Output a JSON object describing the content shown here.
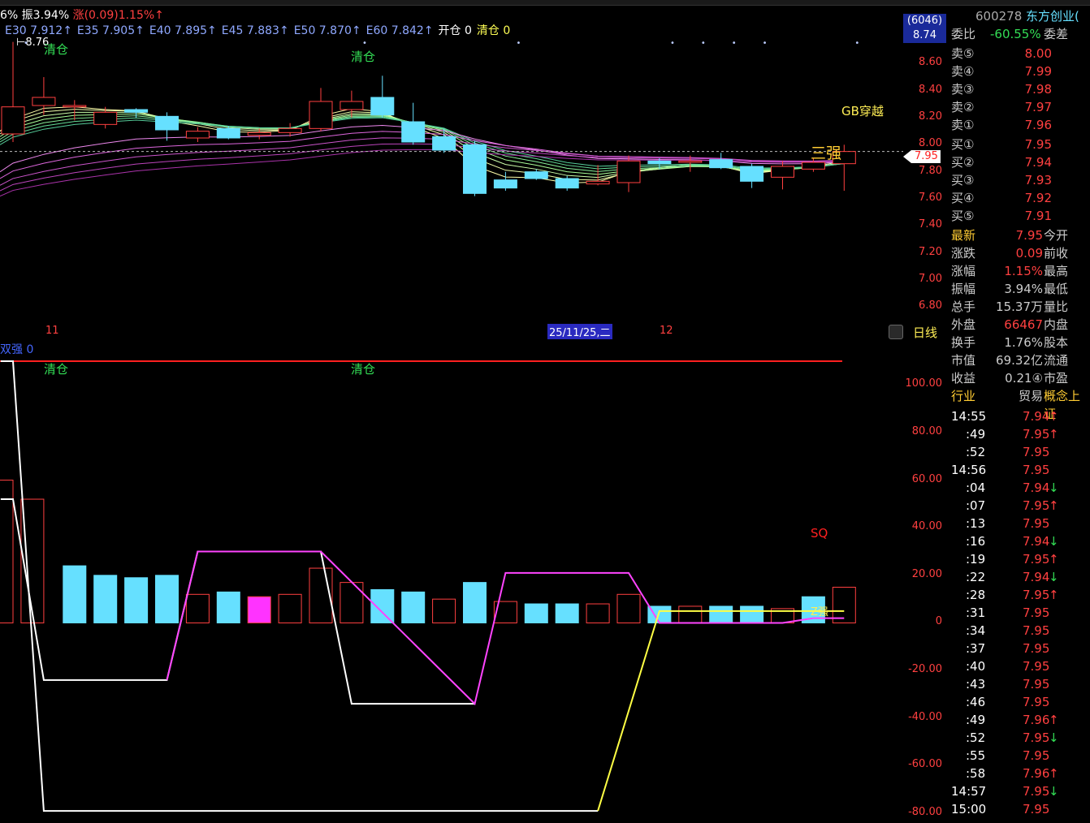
{
  "header": {
    "segments": [
      {
        "text": "6% 振3.94%",
        "color": "#ffffff"
      },
      {
        "text": "涨(0.09)1.15%↑",
        "color": "#ff4040"
      }
    ],
    "ma_labels": [
      {
        "text": "E30 7.912↑",
        "color": "#8fa8ff"
      },
      {
        "text": "E35 7.905↑",
        "color": "#8fa8ff"
      },
      {
        "text": "E40 7.895↑",
        "color": "#8fa8ff"
      },
      {
        "text": "E45 7.883↑",
        "color": "#8fa8ff"
      },
      {
        "text": "E50 7.870↑",
        "color": "#8fa8ff"
      },
      {
        "text": "E60 7.842↑",
        "color": "#8fa8ff"
      },
      {
        "text": "开仓 0",
        "color": "#ffffff"
      },
      {
        "text": "清仓 0",
        "color": "#ffff55"
      }
    ],
    "high_marker": "8.76"
  },
  "main_chart": {
    "labels": {
      "qingcang": "清仓",
      "gb_cross": "GB穿越",
      "san_qiang": "三强",
      "current_price": "7.95"
    },
    "date_labels": {
      "month_11": "11",
      "cursor_date": "25/11/25,二",
      "month_12": "12"
    },
    "period_label": "日线",
    "y_ticks": [
      "8.60",
      "8.40",
      "8.20",
      "8.00",
      "7.80",
      "7.60",
      "7.40",
      "7.20",
      "7.00",
      "6.80"
    ]
  },
  "sub_chart": {
    "title": "双强 0",
    "labels": {
      "qingcang": "清仓",
      "sq": "SQ",
      "z_label": "Z强"
    },
    "y_ticks": [
      "100.00",
      "80.00",
      "60.00",
      "40.00",
      "20.00",
      "0",
      "-20.00",
      "-40.00",
      "-60.00",
      "-80.00"
    ]
  },
  "chart_data": [
    {
      "type": "candlestick",
      "title": "",
      "ylim": [
        6.7,
        8.8
      ],
      "y_ticks": [
        6.8,
        7.0,
        7.2,
        7.4,
        7.6,
        7.8,
        8.0,
        8.2,
        8.4,
        8.6
      ],
      "current_price": 7.95,
      "candles": [
        {
          "o": 8.08,
          "c": 8.28,
          "h": 8.76,
          "l": 8.02
        },
        {
          "o": 8.29,
          "c": 8.35,
          "h": 8.5,
          "l": 8.22
        },
        {
          "o": 8.28,
          "c": 8.29,
          "h": 8.33,
          "l": 8.18
        },
        {
          "o": 8.15,
          "c": 8.24,
          "h": 8.28,
          "l": 8.12
        },
        {
          "o": 8.26,
          "c": 8.24,
          "h": 8.27,
          "l": 8.2
        },
        {
          "o": 8.21,
          "c": 8.11,
          "h": 8.24,
          "l": 8.03
        },
        {
          "o": 8.05,
          "c": 8.1,
          "h": 8.13,
          "l": 8.02
        },
        {
          "o": 8.12,
          "c": 8.05,
          "h": 8.14,
          "l": 8.04
        },
        {
          "o": 8.07,
          "c": 8.09,
          "h": 8.12,
          "l": 8.04
        },
        {
          "o": 8.09,
          "c": 8.12,
          "h": 8.16,
          "l": 8.06
        },
        {
          "o": 8.12,
          "c": 8.32,
          "h": 8.42,
          "l": 8.1
        },
        {
          "o": 8.26,
          "c": 8.32,
          "h": 8.4,
          "l": 8.2
        },
        {
          "o": 8.35,
          "c": 8.22,
          "h": 8.51,
          "l": 8.2
        },
        {
          "o": 8.17,
          "c": 8.02,
          "h": 8.31,
          "l": 8.0
        },
        {
          "o": 8.06,
          "c": 7.96,
          "h": 8.12,
          "l": 7.94
        },
        {
          "o": 8.0,
          "c": 7.64,
          "h": 8.03,
          "l": 7.62
        },
        {
          "o": 7.74,
          "c": 7.68,
          "h": 7.8,
          "l": 7.66
        },
        {
          "o": 7.8,
          "c": 7.75,
          "h": 7.82,
          "l": 7.74
        },
        {
          "o": 7.75,
          "c": 7.68,
          "h": 7.77,
          "l": 7.66
        },
        {
          "o": 7.71,
          "c": 7.73,
          "h": 7.85,
          "l": 7.7
        },
        {
          "o": 7.72,
          "c": 7.88,
          "h": 7.92,
          "l": 7.65
        },
        {
          "o": 7.88,
          "c": 7.86,
          "h": 7.9,
          "l": 7.82
        },
        {
          "o": 7.87,
          "c": 7.88,
          "h": 7.92,
          "l": 7.8
        },
        {
          "o": 7.89,
          "c": 7.83,
          "h": 7.94,
          "l": 7.82
        },
        {
          "o": 7.84,
          "c": 7.73,
          "h": 7.86,
          "l": 7.68
        },
        {
          "o": 7.76,
          "c": 7.84,
          "h": 7.88,
          "l": 7.67
        },
        {
          "o": 7.82,
          "c": 7.87,
          "h": 7.9,
          "l": 7.8
        },
        {
          "o": 7.86,
          "c": 7.95,
          "h": 8.0,
          "l": 7.66
        }
      ],
      "markers": {
        "qingcang_at": [
          1,
          11
        ],
        "san_qiang_at": 26,
        "top_dots_at": [
          0,
          11,
          16,
          21,
          22,
          23,
          24,
          27
        ]
      }
    },
    {
      "type": "bar+line",
      "title": "双强",
      "ylim": [
        -80,
        110
      ],
      "y_ticks": [
        100,
        80,
        60,
        40,
        20,
        0,
        -20,
        -40,
        -60,
        -80
      ],
      "bars": [
        {
          "v": 60,
          "k": "r"
        },
        {
          "v": 52,
          "k": "r"
        },
        {
          "v": 24,
          "k": "c"
        },
        {
          "v": 20,
          "k": "c"
        },
        {
          "v": 19,
          "k": "c"
        },
        {
          "v": 20,
          "k": "c"
        },
        {
          "v": 12,
          "k": "r"
        },
        {
          "v": 13,
          "k": "c"
        },
        {
          "v": 11,
          "k": "m"
        },
        {
          "v": 12,
          "k": "r"
        },
        {
          "v": 23,
          "k": "r"
        },
        {
          "v": 17,
          "k": "r"
        },
        {
          "v": 14,
          "k": "c"
        },
        {
          "v": 13,
          "k": "c"
        },
        {
          "v": 10,
          "k": "r"
        },
        {
          "v": 17,
          "k": "c"
        },
        {
          "v": 9,
          "k": "r"
        },
        {
          "v": 8,
          "k": "c"
        },
        {
          "v": 8,
          "k": "c"
        },
        {
          "v": 8,
          "k": "r"
        },
        {
          "v": 12,
          "k": "r"
        },
        {
          "v": 7,
          "k": "c"
        },
        {
          "v": 7,
          "k": "r"
        },
        {
          "v": 7,
          "k": "c"
        },
        {
          "v": 7,
          "k": "c"
        },
        {
          "v": 6,
          "k": "r"
        },
        {
          "v": 11,
          "k": "c"
        },
        {
          "v": 15,
          "k": "r"
        }
      ],
      "lines": [
        {
          "name": "white-line",
          "color": "#ffffff",
          "points": [
            [
              -0.4,
              110
            ],
            [
              0,
              110
            ],
            [
              1,
              -79
            ],
            [
              19,
              -79
            ]
          ]
        },
        {
          "name": "white-line-2",
          "color": "#ffffff",
          "points": [
            [
              -0.4,
              52
            ],
            [
              0,
              52
            ],
            [
              1,
              -24
            ],
            [
              5,
              -24
            ],
            [
              6,
              30
            ],
            [
              10,
              30
            ],
            [
              11,
              -34
            ],
            [
              15,
              -34
            ]
          ]
        },
        {
          "name": "magenta-line",
          "color": "#ff44ff",
          "points": [
            [
              5,
              -24
            ],
            [
              6,
              30
            ],
            [
              10,
              30
            ],
            [
              15,
              -34
            ],
            [
              16,
              21
            ],
            [
              20,
              21
            ],
            [
              21,
              0
            ],
            [
              25,
              0
            ],
            [
              26,
              2
            ],
            [
              27,
              2
            ]
          ]
        },
        {
          "name": "yellow-line",
          "color": "#ffff44",
          "points": [
            [
              19,
              -79
            ],
            [
              21,
              5
            ],
            [
              27,
              5
            ]
          ]
        }
      ],
      "red_line_value": 110
    }
  ],
  "quote": {
    "code": "600278",
    "name": "东方创业(",
    "badge": "(6046)",
    "badge_val": "8.74",
    "weibi_label": "委比",
    "weibi_val": "-60.55%",
    "weicha_label": "委差",
    "sell": [
      {
        "label": "卖⑤",
        "price": "8.00"
      },
      {
        "label": "卖④",
        "price": "7.99"
      },
      {
        "label": "卖③",
        "price": "7.98"
      },
      {
        "label": "卖②",
        "price": "7.97"
      },
      {
        "label": "卖①",
        "price": "7.96"
      }
    ],
    "buy": [
      {
        "label": "买①",
        "price": "7.95"
      },
      {
        "label": "买②",
        "price": "7.94"
      },
      {
        "label": "买③",
        "price": "7.93"
      },
      {
        "label": "买④",
        "price": "7.92"
      },
      {
        "label": "买⑤",
        "price": "7.91"
      }
    ],
    "stats": [
      {
        "label": "最新",
        "val": "7.95",
        "val_color": "#ff4040",
        "extra": "今开",
        "label_color": "#ffcc33"
      },
      {
        "label": "涨跌",
        "val": "0.09",
        "val_color": "#ff4040",
        "extra": "前收",
        "label_color": "#cccccc"
      },
      {
        "label": "涨幅",
        "val": "1.15%",
        "val_color": "#ff4040",
        "extra": "最高",
        "label_color": "#cccccc"
      },
      {
        "label": "振幅",
        "val": "3.94%",
        "val_color": "#cccccc",
        "extra": "最低",
        "label_color": "#cccccc"
      },
      {
        "label": "总手",
        "val": "15.37万",
        "val_color": "#cccccc",
        "extra": "量比",
        "label_color": "#cccccc"
      },
      {
        "label": "外盘",
        "val": "66467",
        "val_color": "#ff4040",
        "extra": "内盘",
        "label_color": "#cccccc"
      },
      {
        "label": "换手",
        "val": "1.76%",
        "val_color": "#cccccc",
        "extra": "股本",
        "label_color": "#cccccc"
      },
      {
        "label": "市值",
        "val": "69.32亿",
        "val_color": "#cccccc",
        "extra": "流通",
        "label_color": "#cccccc"
      },
      {
        "label": "收益",
        "val": "0.21④",
        "val_color": "#cccccc",
        "extra": "市盈",
        "label_color": "#cccccc"
      },
      {
        "label": "行业",
        "val": "贸易",
        "val_color": "#cccccc",
        "extra": "概念上证",
        "label_color": "#ffcc33"
      }
    ],
    "ticks": [
      {
        "t": "14:55",
        "p": "7.94",
        "a": "↑"
      },
      {
        "t": ":49",
        "p": "7.95",
        "a": "↑"
      },
      {
        "t": ":52",
        "p": "7.95",
        "a": ""
      },
      {
        "t": "14:56",
        "p": "7.95",
        "a": ""
      },
      {
        "t": ":04",
        "p": "7.94",
        "a": "↓"
      },
      {
        "t": ":07",
        "p": "7.95",
        "a": "↑"
      },
      {
        "t": ":13",
        "p": "7.95",
        "a": ""
      },
      {
        "t": ":16",
        "p": "7.94",
        "a": "↓"
      },
      {
        "t": ":19",
        "p": "7.95",
        "a": "↑"
      },
      {
        "t": ":22",
        "p": "7.94",
        "a": "↓"
      },
      {
        "t": ":28",
        "p": "7.95",
        "a": "↑"
      },
      {
        "t": ":31",
        "p": "7.95",
        "a": ""
      },
      {
        "t": ":34",
        "p": "7.95",
        "a": ""
      },
      {
        "t": ":37",
        "p": "7.95",
        "a": ""
      },
      {
        "t": ":40",
        "p": "7.95",
        "a": ""
      },
      {
        "t": ":43",
        "p": "7.95",
        "a": ""
      },
      {
        "t": ":46",
        "p": "7.95",
        "a": ""
      },
      {
        "t": ":49",
        "p": "7.96",
        "a": "↑"
      },
      {
        "t": ":52",
        "p": "7.95",
        "a": "↓"
      },
      {
        "t": ":55",
        "p": "7.95",
        "a": ""
      },
      {
        "t": ":58",
        "p": "7.96",
        "a": "↑"
      },
      {
        "t": "14:57",
        "p": "7.95",
        "a": "↓"
      },
      {
        "t": "15:00",
        "p": "7.95",
        "a": ""
      }
    ]
  },
  "colors": {
    "up": "#ff4040",
    "down": "#66e0ff",
    "bg": "#000000",
    "magenta": "#ff33ff",
    "arrow_up": "#ff4040",
    "arrow_down": "#33dd55"
  }
}
